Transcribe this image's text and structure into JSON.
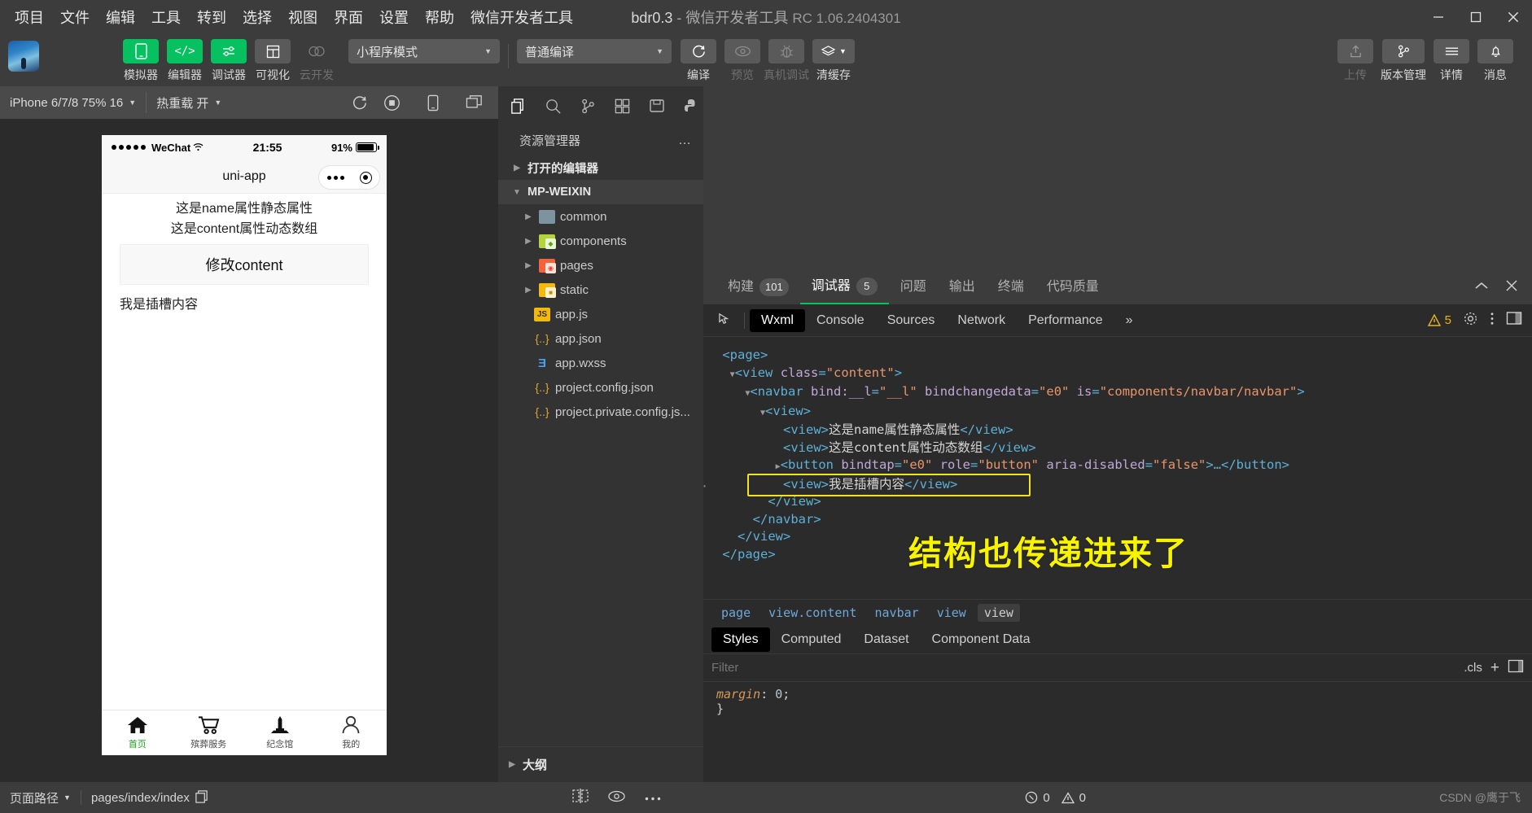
{
  "window": {
    "title_project": "bdr0.3",
    "title_dash": "-",
    "title_app": "微信开发者工具",
    "title_version": "RC 1.06.2404301",
    "minimize": "minimize-icon",
    "maximize": "maximize-icon",
    "close": "close-icon"
  },
  "menu": {
    "items": [
      {
        "label": "项目"
      },
      {
        "label": "文件"
      },
      {
        "label": "编辑"
      },
      {
        "label": "工具"
      },
      {
        "label": "转到"
      },
      {
        "label": "选择"
      },
      {
        "label": "视图"
      },
      {
        "label": "界面"
      },
      {
        "label": "设置"
      },
      {
        "label": "帮助"
      },
      {
        "label": "微信开发者工具"
      }
    ]
  },
  "toolbar": {
    "buttons": [
      {
        "label": "模拟器",
        "icon": "phone-icon",
        "style": "green"
      },
      {
        "label": "编辑器",
        "icon": "code-icon",
        "style": "green"
      },
      {
        "label": "调试器",
        "icon": "sliders-icon",
        "style": "green"
      },
      {
        "label": "可视化",
        "icon": "layout-icon",
        "style": "grey"
      },
      {
        "label": "云开发",
        "icon": "cloud-icon",
        "style": "flat"
      }
    ],
    "mode_select": "小程序模式",
    "compile_select": "普通编译",
    "actions": [
      {
        "label": "编译",
        "icon": "refresh-icon",
        "enabled": true
      },
      {
        "label": "预览",
        "icon": "eye-icon",
        "enabled": false
      },
      {
        "label": "真机调试",
        "icon": "bug-icon",
        "enabled": false
      },
      {
        "label": "清缓存",
        "icon": "layers-icon",
        "enabled": true
      }
    ],
    "right_actions": [
      {
        "label": "上传",
        "icon": "upload-icon",
        "enabled": false
      },
      {
        "label": "版本管理",
        "icon": "branch-icon",
        "enabled": true
      },
      {
        "label": "详情",
        "icon": "menu-icon",
        "enabled": true
      },
      {
        "label": "消息",
        "icon": "bell-icon",
        "enabled": true
      }
    ]
  },
  "simulator": {
    "device_select": "iPhone 6/7/8 75% 16",
    "hotreload_select": "热重载 开",
    "icons": [
      "refresh-icon",
      "record-icon",
      "phone-icon",
      "windows-icon"
    ]
  },
  "phone": {
    "status": {
      "carrier": "WeChat",
      "time": "21:55",
      "battery_percent": "91%"
    },
    "nav_title": "uni-app",
    "content": {
      "line1": "这是name属性静态属性",
      "line2": "这是content属性动态数组",
      "button": "修改content",
      "slot": "我是插槽内容"
    },
    "tabs": [
      {
        "label": "首页",
        "icon": "home-icon",
        "active": true
      },
      {
        "label": "殡葬服务",
        "icon": "cart-icon",
        "active": false
      },
      {
        "label": "纪念馆",
        "icon": "monument-icon",
        "active": false
      },
      {
        "label": "我的",
        "icon": "user-icon",
        "active": false
      }
    ]
  },
  "explorer": {
    "toolbar_icons": [
      "files-icon",
      "search-icon",
      "source-control-icon",
      "extensions-icon",
      "save-icon",
      "python-icon"
    ],
    "title": "资源管理器",
    "more": "…",
    "sections": [
      {
        "label": "打开的编辑器",
        "expanded": false
      },
      {
        "label": "MP-WEIXIN",
        "expanded": true
      }
    ],
    "files": [
      {
        "name": "common",
        "type": "folder",
        "color": "f-grey",
        "expandable": true
      },
      {
        "name": "components",
        "type": "folder",
        "color": "f-green",
        "expandable": true
      },
      {
        "name": "pages",
        "type": "folder",
        "color": "f-red",
        "expandable": true
      },
      {
        "name": "static",
        "type": "folder",
        "color": "f-yellow",
        "expandable": true
      },
      {
        "name": "app.js",
        "type": "js",
        "expandable": false
      },
      {
        "name": "app.json",
        "type": "json",
        "expandable": false
      },
      {
        "name": "app.wxss",
        "type": "wxss",
        "expandable": false
      },
      {
        "name": "project.config.json",
        "type": "json",
        "expandable": false
      },
      {
        "name": "project.private.config.js...",
        "type": "json",
        "expandable": false
      }
    ],
    "outline": "大纲"
  },
  "devtools": {
    "tabs": [
      {
        "label": "构建",
        "badge": "101",
        "active": false
      },
      {
        "label": "调试器",
        "badge": "5",
        "active": true
      },
      {
        "label": "问题",
        "badge": "",
        "active": false
      },
      {
        "label": "输出",
        "badge": "",
        "active": false
      },
      {
        "label": "终端",
        "badge": "",
        "active": false
      },
      {
        "label": "代码质量",
        "badge": "",
        "active": false
      }
    ],
    "collapse_icon": "chevron-up-icon",
    "close_icon": "close-icon",
    "panel_tabs": [
      {
        "label": "Wxml",
        "active": true
      },
      {
        "label": "Console",
        "active": false
      },
      {
        "label": "Sources",
        "active": false
      },
      {
        "label": "Network",
        "active": false
      },
      {
        "label": "Performance",
        "active": false
      }
    ],
    "overflow": "»",
    "warning_count": "5",
    "settings_icon": "gear-icon",
    "kebab_icon": "more-vertical-icon",
    "dock_icon": "dock-icon",
    "annotation": "结构也传递进来了",
    "breadcrumb": [
      {
        "label": "page",
        "active": false
      },
      {
        "label": "view.content",
        "active": false
      },
      {
        "label": "navbar",
        "active": false
      },
      {
        "label": "view",
        "active": false
      },
      {
        "label": "view",
        "active": true
      }
    ],
    "style_tabs": [
      {
        "label": "Styles",
        "active": true
      },
      {
        "label": "Computed",
        "active": false
      },
      {
        "label": "Dataset",
        "active": false
      },
      {
        "label": "Component Data",
        "active": false
      }
    ],
    "filter_placeholder": "Filter",
    "cls_label": ".cls",
    "plus_label": "+",
    "style_rule_prop": "margin",
    "style_rule_value": "0",
    "style_rule_close": "}"
  },
  "wxml_lines": [
    {
      "indent": 0,
      "arrow": "",
      "segs": [
        {
          "t": "tag",
          "v": "<page>"
        }
      ]
    },
    {
      "indent": 1,
      "arrow": "down",
      "segs": [
        {
          "t": "tag",
          "v": "<view "
        },
        {
          "t": "attr",
          "v": "class"
        },
        {
          "t": "tag",
          "v": "="
        },
        {
          "t": "val",
          "v": "\"content\""
        },
        {
          "t": "tag",
          "v": ">"
        }
      ]
    },
    {
      "indent": 2,
      "arrow": "down",
      "segs": [
        {
          "t": "tag",
          "v": "<navbar "
        },
        {
          "t": "attr",
          "v": "bind:__l"
        },
        {
          "t": "tag",
          "v": "="
        },
        {
          "t": "val",
          "v": "\"__l\""
        },
        {
          "t": "tag",
          "v": " "
        },
        {
          "t": "attr",
          "v": "bindchangedata"
        },
        {
          "t": "tag",
          "v": "="
        },
        {
          "t": "val",
          "v": "\"e0\""
        },
        {
          "t": "tag",
          "v": " "
        },
        {
          "t": "attr",
          "v": "is"
        },
        {
          "t": "tag",
          "v": "="
        },
        {
          "t": "val",
          "v": "\"components/navbar/navbar\""
        },
        {
          "t": "tag",
          "v": ">"
        }
      ]
    },
    {
      "indent": 3,
      "arrow": "down",
      "segs": [
        {
          "t": "tag",
          "v": "<view>"
        }
      ]
    },
    {
      "indent": 4,
      "arrow": "",
      "segs": [
        {
          "t": "tag",
          "v": "<view>"
        },
        {
          "t": "text",
          "v": "这是name属性静态属性"
        },
        {
          "t": "tag",
          "v": "</view>"
        }
      ]
    },
    {
      "indent": 4,
      "arrow": "",
      "segs": [
        {
          "t": "tag",
          "v": "<view>"
        },
        {
          "t": "text",
          "v": "这是content属性动态数组"
        },
        {
          "t": "tag",
          "v": "</view>"
        }
      ]
    },
    {
      "indent": 4,
      "arrow": "right",
      "segs": [
        {
          "t": "tag",
          "v": "<button "
        },
        {
          "t": "attr",
          "v": "bindtap"
        },
        {
          "t": "tag",
          "v": "="
        },
        {
          "t": "val",
          "v": "\"e0\""
        },
        {
          "t": "tag",
          "v": " "
        },
        {
          "t": "attr",
          "v": "role"
        },
        {
          "t": "tag",
          "v": "="
        },
        {
          "t": "val",
          "v": "\"button\""
        },
        {
          "t": "tag",
          "v": " "
        },
        {
          "t": "attr",
          "v": "aria-disabled"
        },
        {
          "t": "tag",
          "v": "="
        },
        {
          "t": "val",
          "v": "\"false\""
        },
        {
          "t": "tag",
          "v": ">…</button>"
        }
      ]
    },
    {
      "indent": 4,
      "arrow": "",
      "segs": [
        {
          "t": "tag",
          "v": "<view>"
        },
        {
          "t": "text",
          "v": "我是插槽内容"
        },
        {
          "t": "tag",
          "v": "</view>"
        }
      ],
      "highlighted": true
    },
    {
      "indent": 3,
      "arrow": "",
      "segs": [
        {
          "t": "tag",
          "v": "</view>"
        }
      ]
    },
    {
      "indent": 2,
      "arrow": "",
      "segs": [
        {
          "t": "tag",
          "v": "</navbar>"
        }
      ]
    },
    {
      "indent": 1,
      "arrow": "",
      "segs": [
        {
          "t": "tag",
          "v": "</view>"
        }
      ]
    },
    {
      "indent": 0,
      "arrow": "",
      "segs": [
        {
          "t": "tag",
          "v": "</page>"
        }
      ]
    }
  ],
  "statusbar": {
    "page_path_label": "页面路径",
    "page_path": "pages/index/index",
    "copy_icon": "copy-icon",
    "icons": [
      "split-icon",
      "eye-icon",
      "more-icon"
    ],
    "error_count": "0",
    "warning_count": "0",
    "watermark": "CSDN @鹰于飞"
  }
}
